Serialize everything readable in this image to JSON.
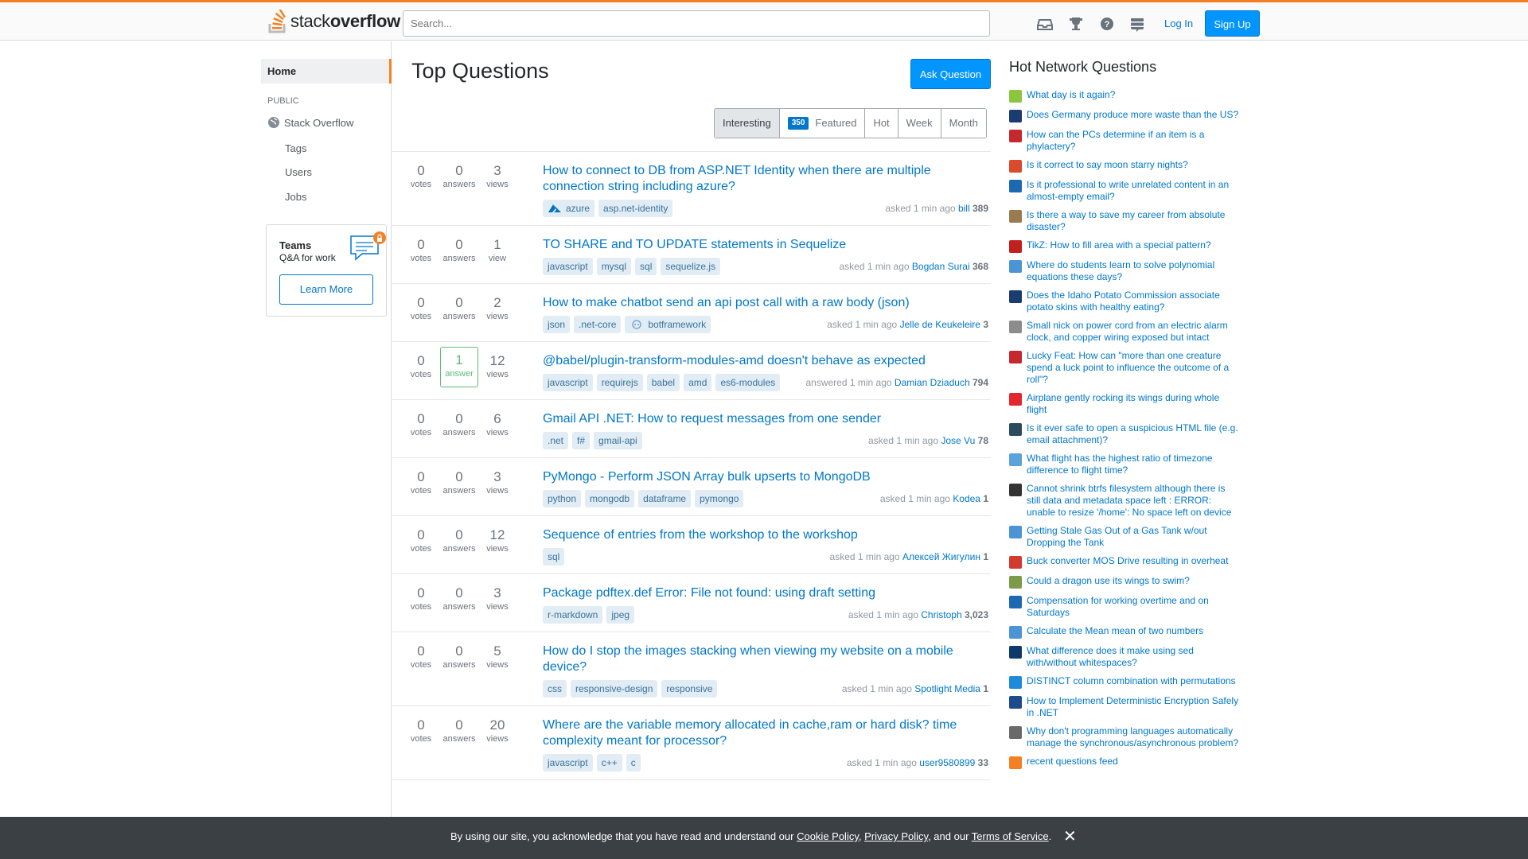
{
  "header": {
    "logo_light": "stack",
    "logo_bold": "overflow",
    "search_placeholder": "Search...",
    "login_label": "Log In",
    "signup_label": "Sign Up",
    "icons": [
      "inbox-icon",
      "trophy-icon",
      "help-icon",
      "stackexchange-icon"
    ]
  },
  "nav": {
    "home": "Home",
    "public": "PUBLIC",
    "stack_overflow": "Stack Overflow",
    "tags": "Tags",
    "users": "Users",
    "jobs": "Jobs",
    "teams_title": "Teams",
    "teams_sub": "Q&A for work",
    "teams_btn": "Learn More"
  },
  "main": {
    "title": "Top Questions",
    "ask_label": "Ask Question",
    "filters": {
      "interesting": "Interesting",
      "featured_count": "350",
      "featured": "Featured",
      "hot": "Hot",
      "week": "Week",
      "month": "Month"
    },
    "questions": [
      {
        "votes": "0",
        "votes_l": "votes",
        "answers": "0",
        "answers_l": "answers",
        "views": "3",
        "views_l": "views",
        "title": "How to connect to DB from ASP.NET Identity when there are multiple connection string including azure?",
        "tags": [
          "azure",
          "asp.net-identity"
        ],
        "action": "asked 1 min ago",
        "user": "bill",
        "rep": "389"
      },
      {
        "votes": "0",
        "votes_l": "votes",
        "answers": "0",
        "answers_l": "answers",
        "views": "1",
        "views_l": "view",
        "title": "TO SHARE and TO UPDATE statements in Sequelize",
        "tags": [
          "javascript",
          "mysql",
          "sql",
          "sequelize.js"
        ],
        "action": "asked 1 min ago",
        "user": "Bogdan Surai",
        "rep": "368"
      },
      {
        "votes": "0",
        "votes_l": "votes",
        "answers": "0",
        "answers_l": "answers",
        "views": "2",
        "views_l": "views",
        "title": "How to make chatbot send an api post call with a raw body (json)",
        "tags": [
          "json",
          ".net-core",
          "botframework"
        ],
        "action": "asked 1 min ago",
        "user": "Jelle de Keukeleire",
        "rep": "3"
      },
      {
        "votes": "0",
        "votes_l": "votes",
        "answers": "1",
        "answers_l": "answer",
        "views": "12",
        "views_l": "views",
        "title": "@babel/plugin-transform-modules-amd doesn't behave as expected",
        "tags": [
          "javascript",
          "requirejs",
          "babel",
          "amd",
          "es6-modules"
        ],
        "action": "answered 1 min ago",
        "user": "Damian Dziaduch",
        "rep": "794"
      },
      {
        "votes": "0",
        "votes_l": "votes",
        "answers": "0",
        "answers_l": "answers",
        "views": "6",
        "views_l": "views",
        "title": "Gmail API .NET: How to request messages from one sender",
        "tags": [
          ".net",
          "f#",
          "gmail-api"
        ],
        "action": "asked 1 min ago",
        "user": "Jose Vu",
        "rep": "78"
      },
      {
        "votes": "0",
        "votes_l": "votes",
        "answers": "0",
        "answers_l": "answers",
        "views": "3",
        "views_l": "views",
        "title": "PyMongo - Perform JSON Array bulk upserts to MongoDB",
        "tags": [
          "python",
          "mongodb",
          "dataframe",
          "pymongo"
        ],
        "action": "asked 1 min ago",
        "user": "Kodea",
        "rep": "1"
      },
      {
        "votes": "0",
        "votes_l": "votes",
        "answers": "0",
        "answers_l": "answers",
        "views": "12",
        "views_l": "views",
        "title": "Sequence of entries from the workshop to the workshop",
        "tags": [
          "sql"
        ],
        "action": "asked 1 min ago",
        "user": "Алексей Жигулин",
        "rep": "1"
      },
      {
        "votes": "0",
        "votes_l": "votes",
        "answers": "0",
        "answers_l": "answers",
        "views": "3",
        "views_l": "views",
        "title": "Package pdftex.def Error: File not found: using draft setting",
        "tags": [
          "r-markdown",
          "jpeg"
        ],
        "action": "asked 1 min ago",
        "user": "Christoph",
        "rep": "3,023"
      },
      {
        "votes": "0",
        "votes_l": "votes",
        "answers": "0",
        "answers_l": "answers",
        "views": "5",
        "views_l": "views",
        "title": "How do I stop the images stacking when viewing my website on a mobile device?",
        "tags": [
          "css",
          "responsive-design",
          "responsive"
        ],
        "action": "asked 1 min ago",
        "user": "Spotlight Media",
        "rep": "1"
      },
      {
        "votes": "0",
        "votes_l": "votes",
        "answers": "0",
        "answers_l": "answers",
        "views": "20",
        "views_l": "views",
        "title": "Where are the variable memory allocated in cache,ram or hard disk? time complexity meant for processor?",
        "tags": [
          "javascript",
          "c++",
          "c"
        ],
        "action": "asked 1 min ago",
        "user": "user9580899",
        "rep": "33"
      }
    ]
  },
  "hnq": {
    "title": "Hot Network Questions",
    "items": [
      {
        "text": "What day is it again?",
        "color": "#8cc63f"
      },
      {
        "text": "Does Germany produce more waste than the US?",
        "color": "#1a3c6e"
      },
      {
        "text": "How can the PCs determine if an item is a phylactery?",
        "color": "#c5282f"
      },
      {
        "text": "Is it correct to say moon starry nights?",
        "color": "#d94b2b"
      },
      {
        "text": "Is it professional to write unrelated content in an almost-empty email?",
        "color": "#1d68b1"
      },
      {
        "text": "Is there a way to save my career from absolute disaster?",
        "color": "#9a7b4f"
      },
      {
        "text": "TikZ: How to fill area with a special pattern?",
        "color": "#c21f1f"
      },
      {
        "text": "Where do students learn to solve polynomial equations these days?",
        "color": "#4c94d4"
      },
      {
        "text": "Does the Idaho Potato Commission associate potato skins with healthy eating?",
        "color": "#1a3c6e"
      },
      {
        "text": "Small nick on power cord from an electric alarm clock, and copper wiring exposed but intact",
        "color": "#8c8c8c"
      },
      {
        "text": "Lucky Feat: How can \"more than one creature spend a luck point to influence the outcome of a roll\"?",
        "color": "#c5282f"
      },
      {
        "text": "Airplane gently rocking its wings during whole flight",
        "color": "#e2272d"
      },
      {
        "text": "Is it ever safe to open a suspicious HTML file (e.g. email attachment)?",
        "color": "#2d4b5f"
      },
      {
        "text": "What flight has the highest ratio of timezone difference to flight time?",
        "color": "#5ba3d9"
      },
      {
        "text": "Cannot shrink btrfs filesystem although there is still data and metadata space left : ERROR: unable to resize '/home': No space left on device",
        "color": "#333333"
      },
      {
        "text": "Getting Stale Gas Out of a Gas Tank w/out Dropping the Tank",
        "color": "#4c94d4"
      },
      {
        "text": "Buck converter MOS Drive resulting in overheat",
        "color": "#d13c2f"
      },
      {
        "text": "Could a dragon use its wings to swim?",
        "color": "#7b9b4b"
      },
      {
        "text": "Compensation for working overtime and on Saturdays",
        "color": "#1d68b1"
      },
      {
        "text": "Calculate the Mean mean of two numbers",
        "color": "#4c94d4"
      },
      {
        "text": "What difference does it make using sed with/without whitespaces?",
        "color": "#0d3a6b"
      },
      {
        "text": "DISTINCT column combination with permutations",
        "color": "#1f8ad7"
      },
      {
        "text": "How to Implement Deterministic Encryption Safely in .NET",
        "color": "#1e4c8a"
      },
      {
        "text": "Why don't programming languages automatically manage the synchronous/asynchronous problem?",
        "color": "#6a6a6a"
      }
    ],
    "feed": "recent questions feed"
  },
  "cookie": {
    "prefix": "By using our site, you acknowledge that you have read and understand our",
    "cookie_policy": "Cookie Policy",
    "sep1": ",",
    "privacy_policy": "Privacy Policy",
    "sep2": ", and our",
    "terms": "Terms of Service",
    "suffix": ".",
    "close": "✕"
  }
}
